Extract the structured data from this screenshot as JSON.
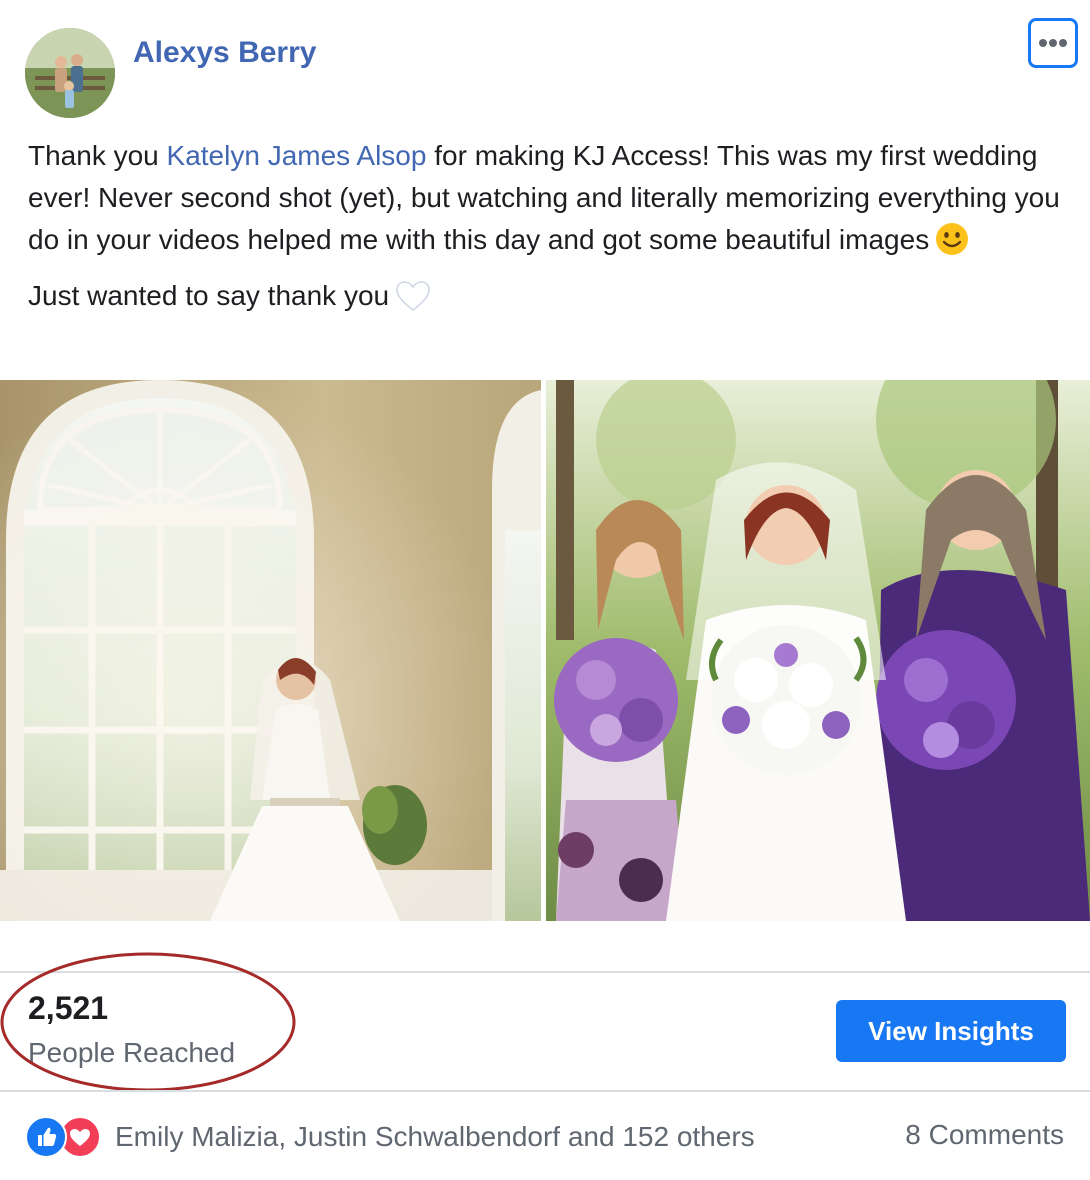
{
  "post": {
    "author": "Alexys Berry",
    "text": {
      "line1_prefix": "Thank you ",
      "mention": "Katelyn James Alsop",
      "line1_rest": " for making KJ Access! This was my first wedding ever! Never second shot (yet), but watching and literally memorizing everything you do in your videos helped me with this day and got some beautiful images",
      "second_paragraph": "Just wanted to say thank you"
    },
    "icons": {
      "menu": "more-options-icon",
      "smile": "slightly-smiling-face-emoji",
      "heart": "white-heart-emoji"
    }
  },
  "stats": {
    "reach_number": "2,521",
    "reach_label": "People Reached",
    "insights_button": "View Insights"
  },
  "footer": {
    "reaction_icons": [
      "like-reaction-icon",
      "love-reaction-icon"
    ],
    "reactors_text": "Emily Malizia, Justin Schwalbendorf and 152 others",
    "comments_text": "8 Comments"
  },
  "colors": {
    "author_link": "#4267b2",
    "primary_button": "#1877f2",
    "annotation_circle": "#a52a2a",
    "like": "#1877f2",
    "love": "#f33e58"
  }
}
